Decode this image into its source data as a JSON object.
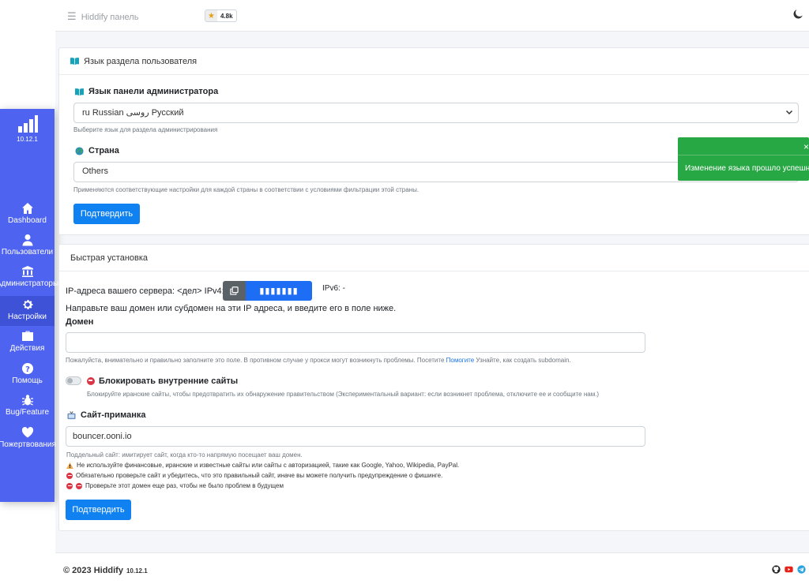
{
  "sidebar": {
    "version": "10.12.1",
    "items": [
      {
        "label": "Dashboard",
        "icon": "home-icon"
      },
      {
        "label": "Пользователи",
        "icon": "user-icon"
      },
      {
        "label": "Администраторы",
        "icon": "admin-icon"
      },
      {
        "label": "Настройки",
        "icon": "gear-icon",
        "active": true
      },
      {
        "label": "Действия",
        "icon": "briefcase-icon"
      },
      {
        "label": "Помощь",
        "icon": "question-icon"
      },
      {
        "label": "Bug/Feature",
        "icon": "bug-icon"
      },
      {
        "label": "Пожертвования",
        "icon": "heart-icon"
      }
    ]
  },
  "topbar": {
    "brand": "Hiddify панель",
    "stars": "4.8k"
  },
  "lang_card": {
    "header": "Язык раздела пользователя",
    "admin_lang_label": "Язык панели администратора",
    "admin_lang_value": "ru Russian روسی Русский",
    "admin_lang_help": "Выберите язык для раздела администрирования",
    "country_label": "Страна",
    "country_value": "Others",
    "country_help": "Применяются соответствующие настройки для каждой страны в соответствии с условиями фильтрации этой страны.",
    "submit": "Подтвердить"
  },
  "toast": {
    "message": "Изменение языка прошло успешно",
    "close": "×"
  },
  "quick_card": {
    "header": "Быстрая установка",
    "ip_text": "IP-адреса вашего сервера: <дел> IPv4:",
    "ip_masked": "▮▮▮▮▮▮▮",
    "ipv6": "IPv6: -",
    "direct_text": "Направьте ваш домен или субдомен на эти IP адреса, и введите его в поле ниже.",
    "domain_label": "Домен",
    "domain_value": "",
    "domain_help_pre": "Пожалуйста, внимательно и правильно заполните это поле. В противном случае у прокси могут возникнуть проблемы. Посетите ",
    "domain_help_link": "Помогите",
    "domain_help_post": " Узнайте, как создать subdomain.",
    "block_label": "Блокировать внутренние сайты",
    "block_help": "Блокируйте иранские сайты, чтобы предотвратить их обнаружение правительством (Экспериментальный вариант: если возникнет проблема, отключите ее и сообщите нам.)",
    "decoy_label": "Сайт-приманка",
    "decoy_value": "bouncer.ooni.io",
    "decoy_help": "Поддельный сайт: имитирует сайт, когда кто-то напрямую посещает ваш домен.",
    "warn1": "Не используйте финансовые, иранские и известные сайты или сайты с авторизацией, такие как Google, Yahoo, Wikipedia, PayPal.",
    "warn2": "Обязательно проверьте сайт и убедитесь, что это правильный сайт, иначе вы можете получить предупреждение о фишинге.",
    "warn3": "Проверьте этот домен еще раз, чтобы не было проблем в будущем",
    "submit": "Подтвердить"
  },
  "footer": {
    "copyright": "© 2023 Hiddify",
    "version": "10.12.1"
  },
  "colors": {
    "sidebar": "#4e63f0",
    "primary": "#1081f1",
    "success": "#28a745"
  }
}
